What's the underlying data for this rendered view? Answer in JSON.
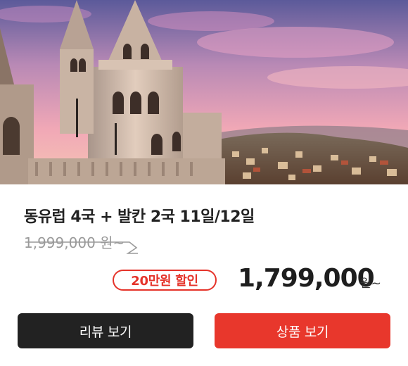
{
  "product": {
    "title": "동유럽 4국 + 발칸 2국 11일/12일",
    "original_price": "1,999,000 원~",
    "discount_badge": "20만원 할인",
    "sale_price": "1,799,000",
    "sale_price_unit": "원~"
  },
  "buttons": {
    "review_label": "리뷰 보기",
    "product_label": "상품 보기"
  },
  "colors": {
    "accent_red": "#e8372c",
    "dark_button": "#222222",
    "strike_gray": "#9a9a9a"
  },
  "image": {
    "icon": "castle-sunset-photo"
  }
}
